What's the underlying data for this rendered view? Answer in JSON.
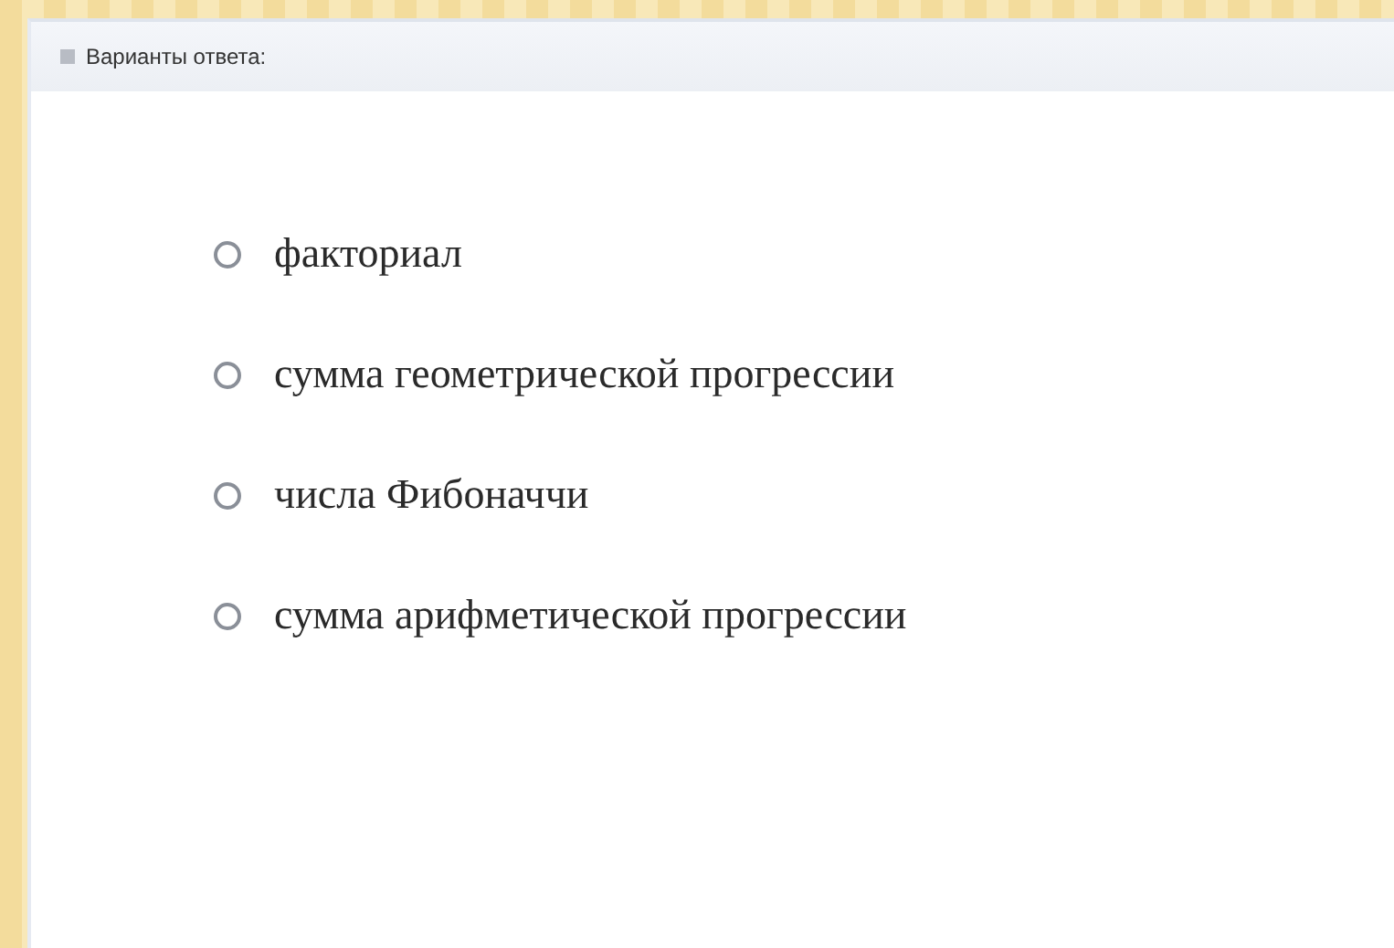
{
  "panel": {
    "title": "Варианты ответа:"
  },
  "options": [
    {
      "label": "факториал",
      "selected": false
    },
    {
      "label": "сумма геометрической прогрессии",
      "selected": false
    },
    {
      "label": "числа Фибоначчи",
      "selected": false
    },
    {
      "label": "сумма арифметической прогрессии",
      "selected": false
    }
  ]
}
